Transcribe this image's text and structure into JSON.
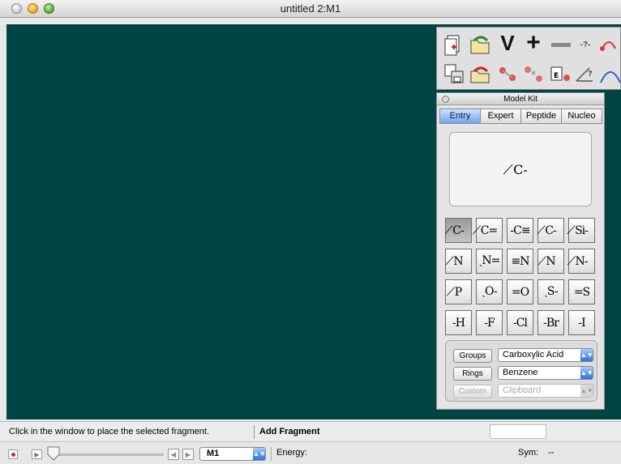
{
  "window": {
    "title": "untitled 2:M1"
  },
  "model_kit": {
    "title": "Model Kit",
    "tabs": [
      "Entry",
      "Expert",
      "Peptide",
      "Nucleo"
    ],
    "active_tab": "Entry",
    "preview_fragment": "̸C-",
    "fragments": [
      [
        "̸C-",
        "̸C=",
        "-C≡",
        "̸C-",
        "̸Si-"
      ],
      [
        "̸N",
        "ˎN=",
        "≡N",
        "̸N",
        "̸N-"
      ],
      [
        "̸P",
        "ˎO-",
        "=O",
        "ˎS-",
        "=S"
      ],
      [
        "-H",
        "-F",
        "-Cl",
        "-Br",
        "-I"
      ]
    ],
    "selected_fragment": "̸C-",
    "groups_button": "Groups",
    "groups_value": "Carboxylic Acid",
    "rings_button": "Rings",
    "rings_value": "Benzene",
    "custom_button": "Custom",
    "custom_value": "Clipboard"
  },
  "toolbar": {
    "icons": [
      "new-document-icon",
      "open-icon",
      "view-icon",
      "add-icon",
      "delete-icon",
      "query-icon",
      "torsion-icon",
      "save-icon",
      "save-as-icon",
      "bond-icon",
      "break-bond-icon",
      "energy-icon",
      "angle-icon",
      "curve-icon"
    ],
    "labels": {
      "view": "V",
      "query": "-?-"
    }
  },
  "status": {
    "message": "Click in the window to place the selected fragment.",
    "mode": "Add Fragment"
  },
  "bottom": {
    "model": "M1",
    "energy_label": "Energy:",
    "sym_label": "Sym:",
    "sym_value": "--"
  },
  "colors": {
    "canvas": "#004444",
    "accent": "#2b74e0"
  }
}
